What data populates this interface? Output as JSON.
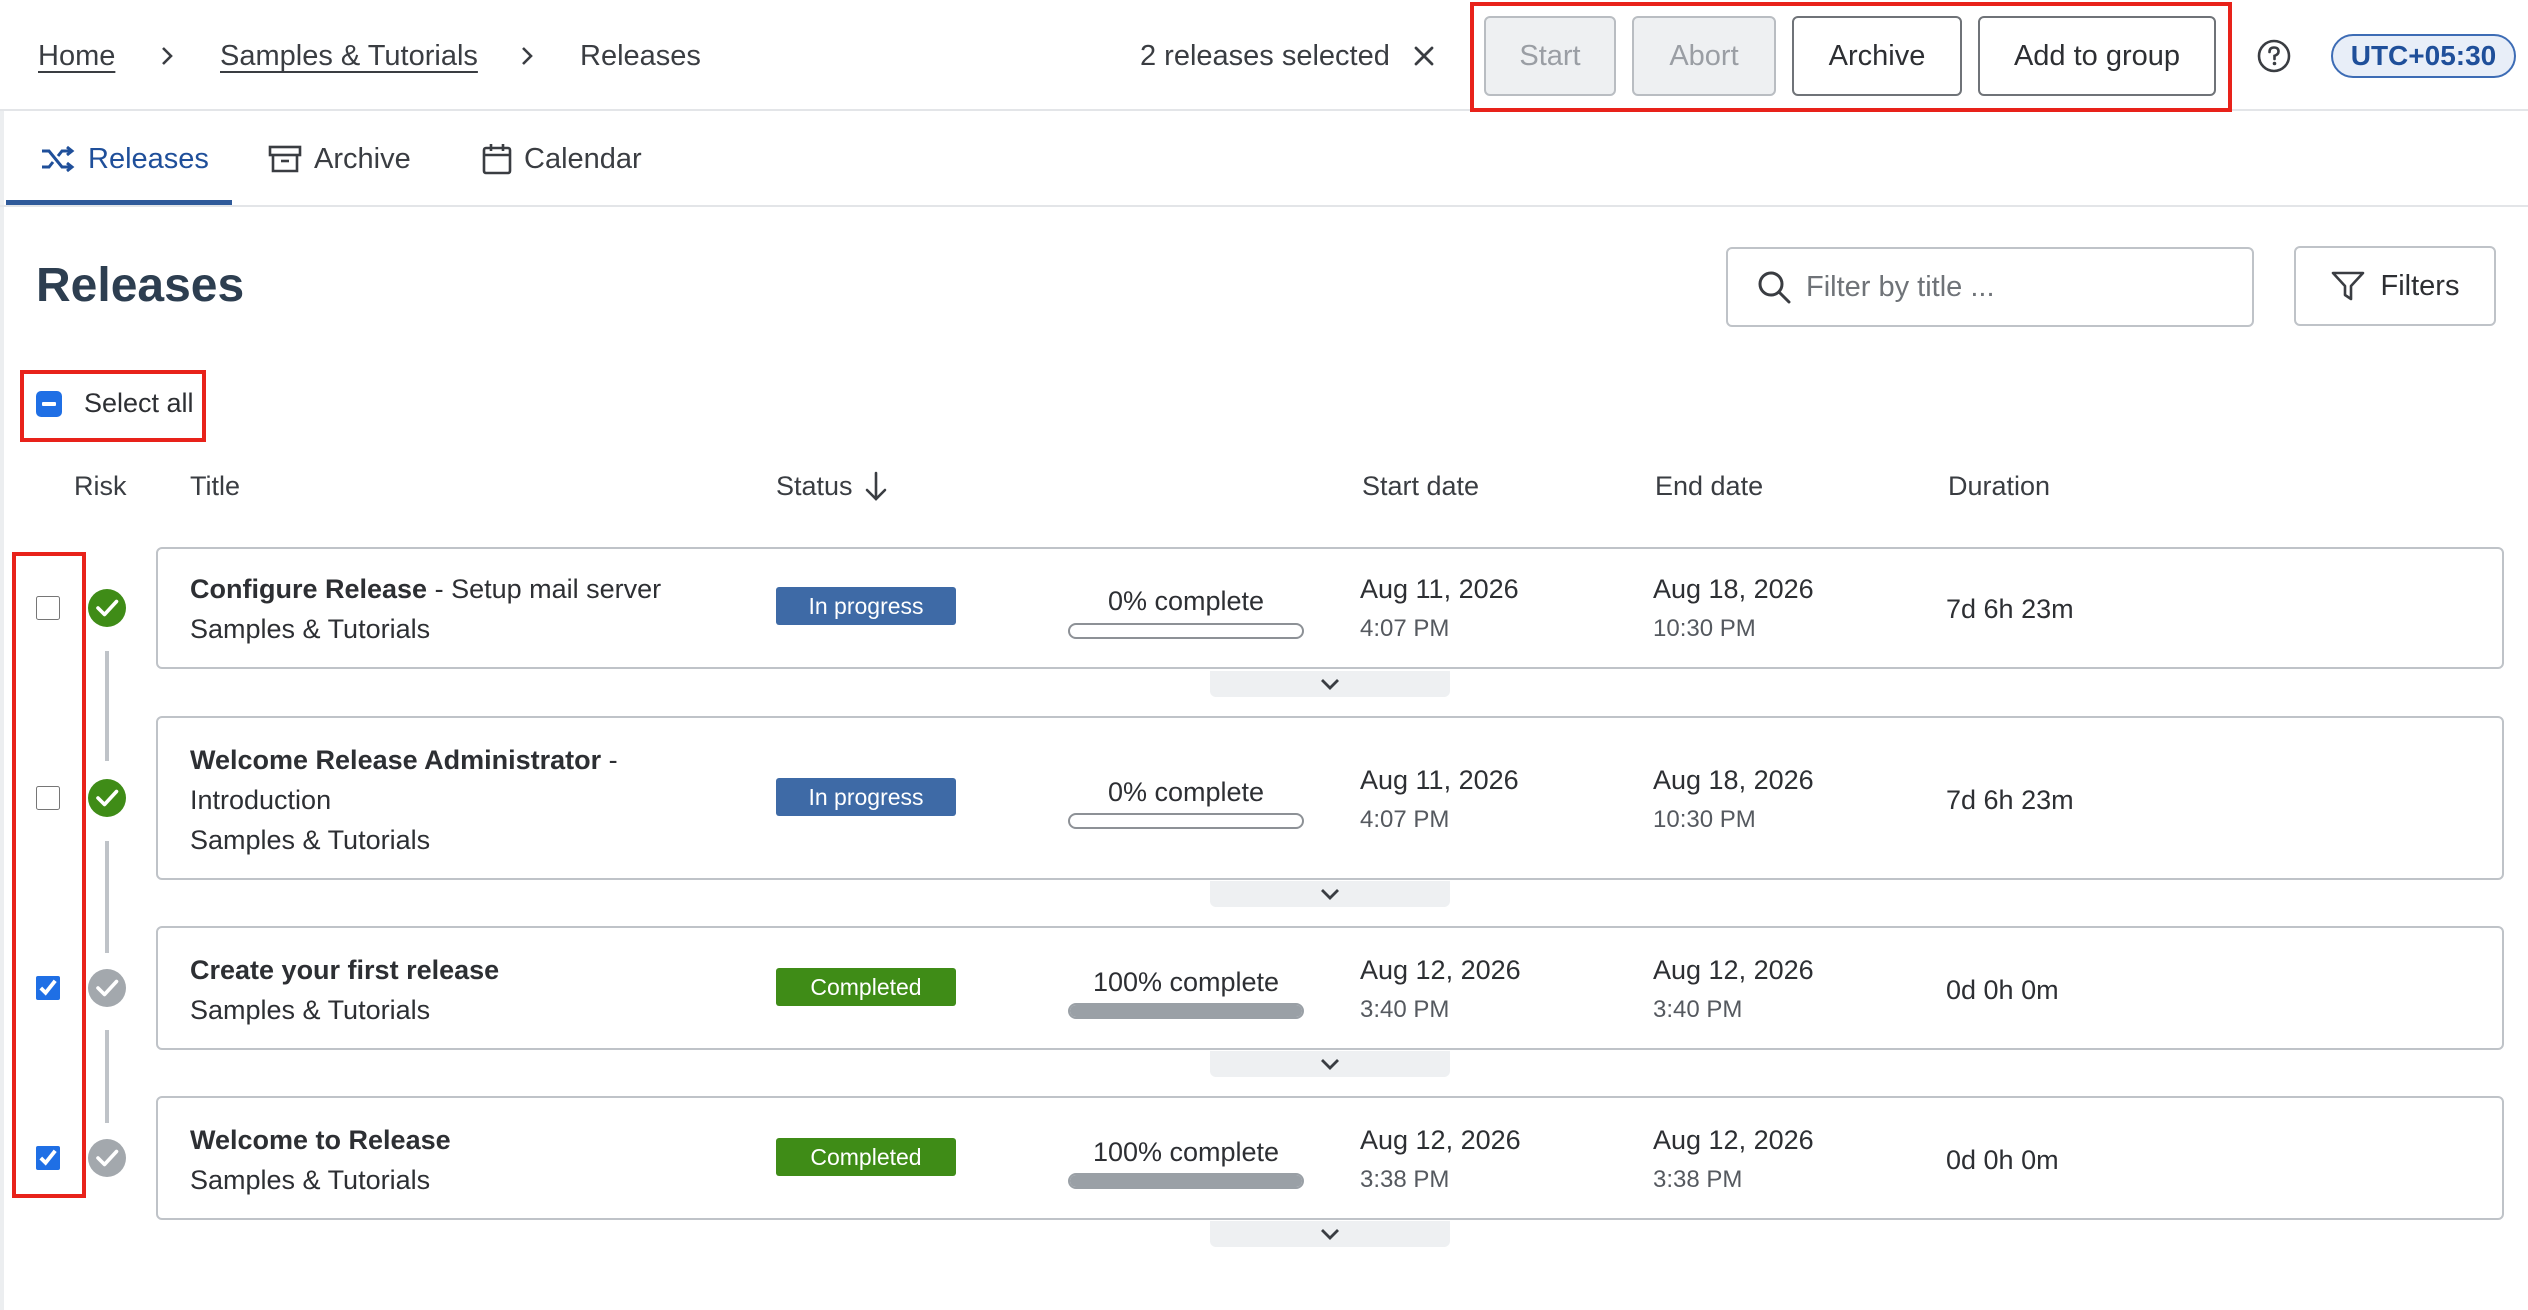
{
  "breadcrumb": {
    "home": "Home",
    "folder": "Samples & Tutorials",
    "current": "Releases"
  },
  "selection": {
    "count_text": "2 releases selected"
  },
  "actions": {
    "start": "Start",
    "abort": "Abort",
    "archive": "Archive",
    "add_to_group": "Add to group"
  },
  "timezone": "UTC+05:30",
  "tabs": [
    {
      "label": "Releases",
      "active": true
    },
    {
      "label": "Archive"
    },
    {
      "label": "Calendar"
    }
  ],
  "page": {
    "title": "Releases"
  },
  "search": {
    "placeholder": "Filter by title ..."
  },
  "filters_label": "Filters",
  "select_all_label": "Select all",
  "columns": {
    "risk": "Risk",
    "title": "Title",
    "status": "Status",
    "start_date": "Start date",
    "end_date": "End date",
    "duration": "Duration"
  },
  "releases": [
    {
      "name": "Configure Release",
      "subtitle": " - Setup mail server",
      "folder": "Samples & Tutorials",
      "status": "In progress",
      "progress": 0,
      "progress_label": "0% complete",
      "start_date": "Aug 11, 2026",
      "start_time": "4:07 PM",
      "end_date": "Aug 18, 2026",
      "end_time": "10:30 PM",
      "duration": "7d 6h 23m",
      "checked": false,
      "risk": "green"
    },
    {
      "name": "Welcome Release Administrator",
      "subtitle": " -",
      "subtitle2": "Introduction",
      "folder": "Samples & Tutorials",
      "status": "In progress",
      "progress": 0,
      "progress_label": "0% complete",
      "start_date": "Aug 11, 2026",
      "start_time": "4:07 PM",
      "end_date": "Aug 18, 2026",
      "end_time": "10:30 PM",
      "duration": "7d 6h 23m",
      "checked": false,
      "risk": "green"
    },
    {
      "name": "Create your first release",
      "folder": "Samples & Tutorials",
      "status": "Completed",
      "progress": 100,
      "progress_label": "100% complete",
      "start_date": "Aug 12, 2026",
      "start_time": "3:40 PM",
      "end_date": "Aug 12, 2026",
      "end_time": "3:40 PM",
      "duration": "0d 0h 0m",
      "checked": true,
      "risk": "grey"
    },
    {
      "name": "Welcome to Release",
      "folder": "Samples & Tutorials",
      "status": "Completed",
      "progress": 100,
      "progress_label": "100% complete",
      "start_date": "Aug 12, 2026",
      "start_time": "3:38 PM",
      "end_date": "Aug 12, 2026",
      "end_time": "3:38 PM",
      "duration": "0d 0h 0m",
      "checked": true,
      "risk": "grey"
    }
  ],
  "colors": {
    "accent": "#1f6fe5",
    "in_progress": "#3e6aa6",
    "completed": "#3f8c17",
    "risk_ok": "#3f8c17",
    "risk_done": "#a3a8ad",
    "highlight": "#e8221a"
  }
}
